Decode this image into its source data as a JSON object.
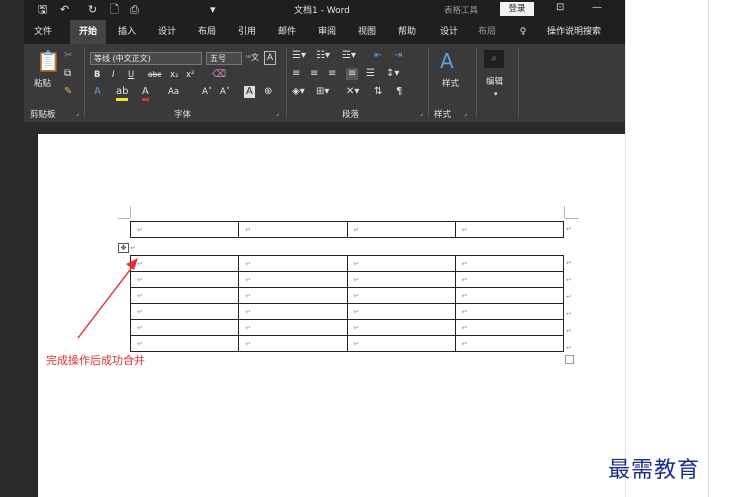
{
  "window": {
    "title": "文档1  -  Word",
    "table_tools": "表格工具",
    "login": "登录"
  },
  "quick_access": {
    "save": "🖫",
    "undo": "↶",
    "redo": "↻",
    "new": "🗋",
    "print_preview": "⎙",
    "more": "▾"
  },
  "tabs": [
    "文件",
    "开始",
    "插入",
    "设计",
    "布局",
    "引用",
    "邮件",
    "审阅",
    "视图",
    "帮助",
    "设计",
    "布局",
    "操作说明搜索"
  ],
  "active_tab": "开始",
  "ribbon": {
    "clipboard": {
      "paste_label": "粘贴",
      "group_label": "剪贴板"
    },
    "font": {
      "font_name": "等线 (中文正文)",
      "font_size": "五号",
      "group_label": "字体",
      "bold": "B",
      "italic": "I",
      "underline": "U",
      "strike": "abc",
      "subscript": "x₂",
      "superscript": "x²",
      "grow": "A˄",
      "shrink": "A˅",
      "case": "Aa"
    },
    "paragraph": {
      "group_label": "段落"
    },
    "styles": {
      "label": "样式",
      "group_label": "样式"
    },
    "editing": {
      "label": "编辑"
    }
  },
  "document": {
    "paragraph_mark": "↵",
    "table_top": {
      "rows": 1,
      "cols": 4
    },
    "table_bottom": {
      "rows": 6,
      "cols": 4
    },
    "caption": "完成操作后成功合并",
    "handle": "✥"
  },
  "watermark": "最需教育",
  "colors": {
    "accent_red": "#e03030",
    "watermark_blue": "#1a2f8a",
    "titlebar": "#1f1f1f",
    "ribbon": "#3a3a3a"
  }
}
